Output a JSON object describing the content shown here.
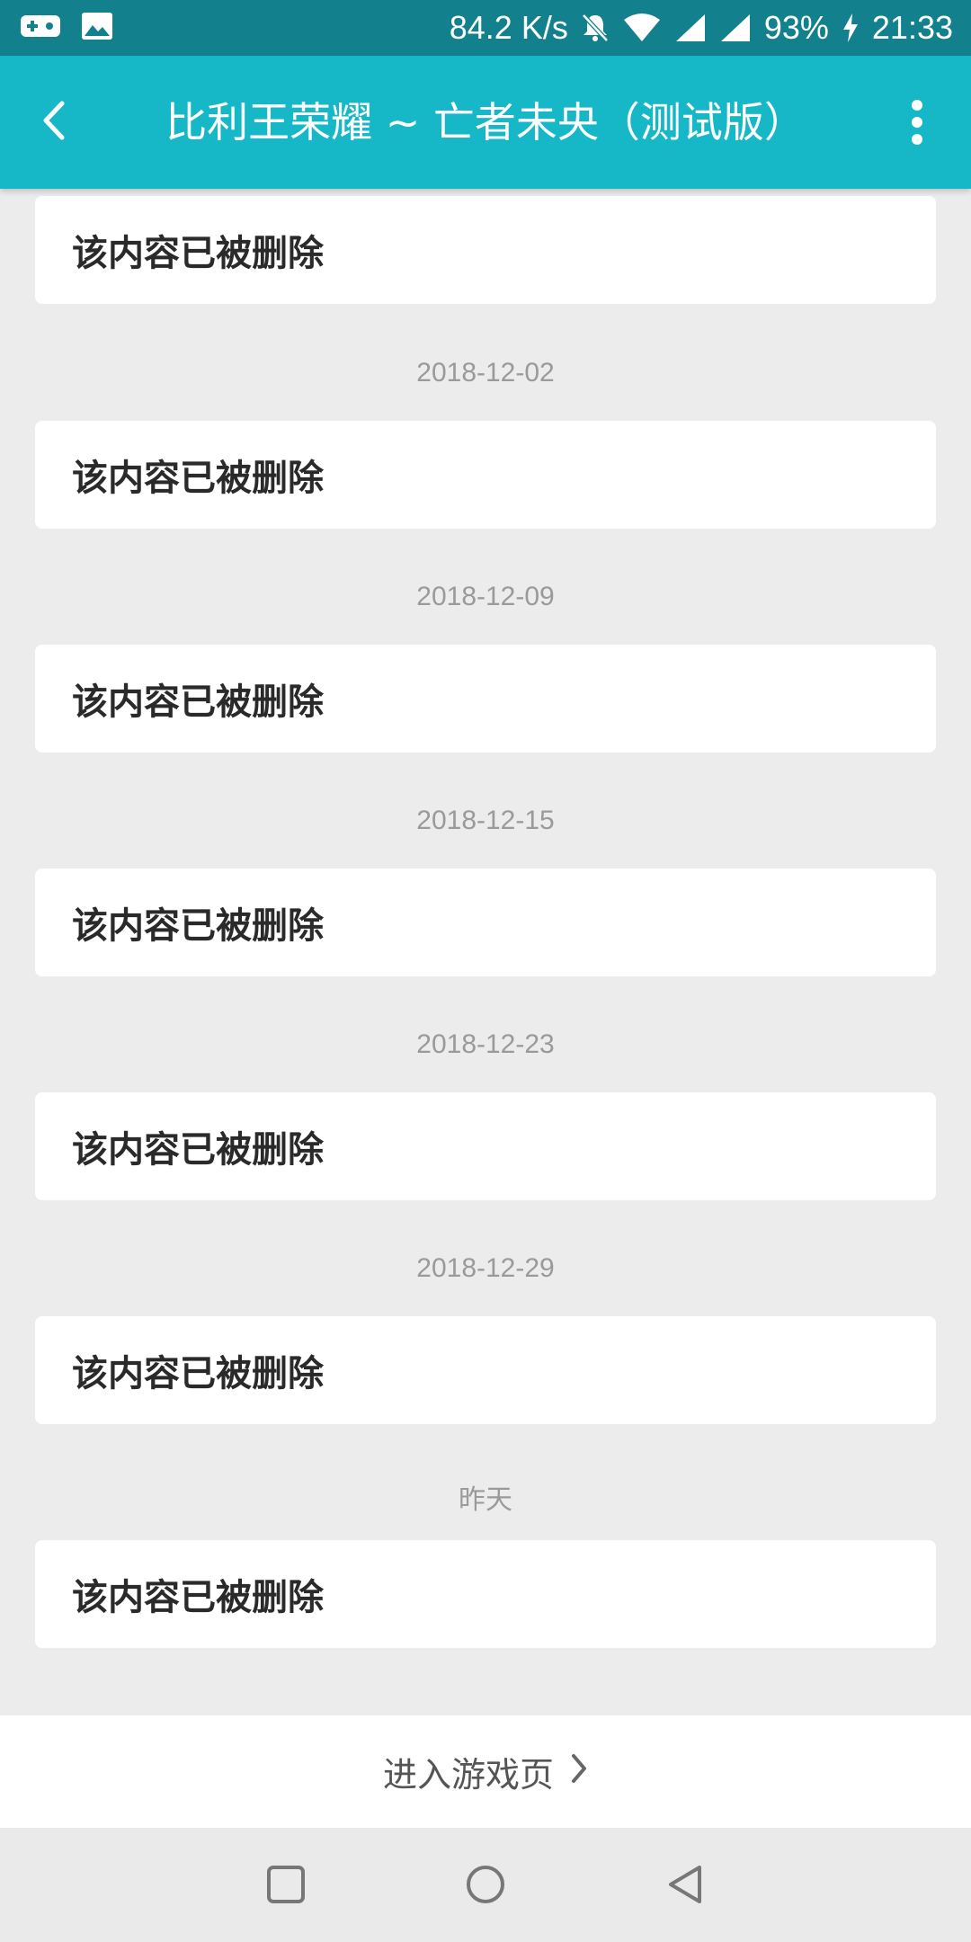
{
  "status_bar": {
    "net_speed": "84.2 K/s",
    "battery": "93%",
    "time": "21:33",
    "icons": [
      "game-controller-icon",
      "image-icon",
      "bell-off-icon",
      "wifi-icon",
      "signal-icon",
      "signal-icon",
      "charging-icon"
    ]
  },
  "header": {
    "title": "比利王荣耀 ~ 亡者未央（测试版）",
    "back_icon": "chevron-left-icon",
    "menu_icon": "more-vertical-icon"
  },
  "feed": [
    {
      "date": null,
      "text": "该内容已被删除"
    },
    {
      "date": "2018-12-02",
      "text": "该内容已被删除"
    },
    {
      "date": "2018-12-09",
      "text": "该内容已被删除"
    },
    {
      "date": "2018-12-15",
      "text": "该内容已被删除"
    },
    {
      "date": "2018-12-23",
      "text": "该内容已被删除"
    },
    {
      "date": "2018-12-29",
      "text": "该内容已被删除"
    },
    {
      "date": "昨天",
      "text": "该内容已被删除"
    }
  ],
  "footer": {
    "enter_game_label": "进入游戏页",
    "arrow_icon": "chevron-right-icon"
  },
  "nav_bar": {
    "buttons": [
      "recent-apps-icon",
      "home-icon",
      "back-icon"
    ]
  },
  "colors": {
    "status_bar": "#13808e",
    "app_bar": "#16b8c8",
    "background": "#ececec"
  }
}
